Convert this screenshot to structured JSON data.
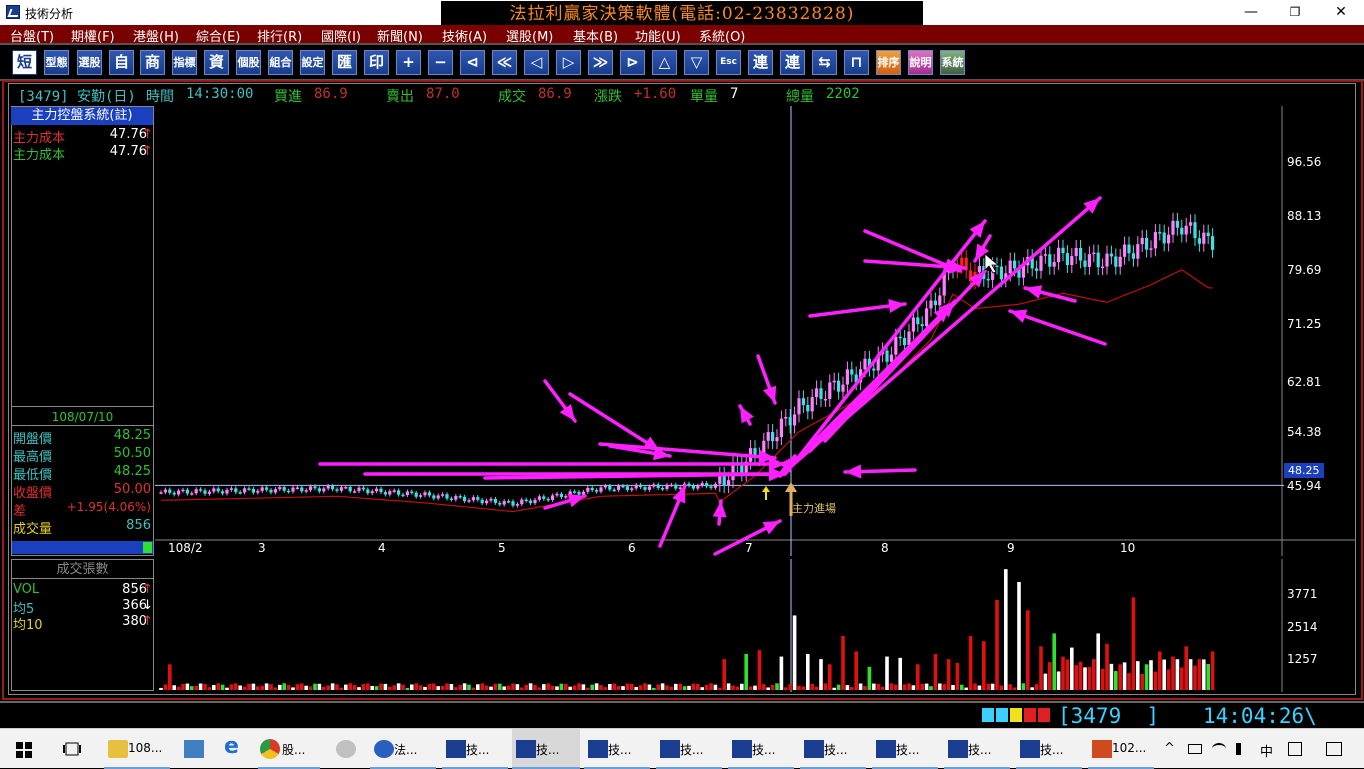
{
  "window": {
    "title": "技術分析",
    "banner": "法拉利贏家決策軟體(電話:02-23832828)",
    "minimize": "—",
    "maximize": "❐",
    "close": "✕"
  },
  "menu": [
    "台盤(T)",
    "期權(F)",
    "港盤(H)",
    "綜合(E)",
    "排行(R)",
    "國際(I)",
    "新聞(N)",
    "技術(A)",
    "選股(M)",
    "基本(B)",
    "功能(U)",
    "系統(O)"
  ],
  "toolbar": [
    "短",
    "型態",
    "選股",
    "自",
    "商",
    "指標",
    "資",
    "個股",
    "組合",
    "設定",
    "匯",
    "印",
    "+",
    "−",
    "⊲",
    "≪",
    "◁",
    "▷",
    "≫",
    "⊳",
    "△",
    "▽",
    "Esc",
    "連",
    "連",
    "⇆",
    "⊓",
    "排序",
    "說明",
    "系統"
  ],
  "info": {
    "code": "[3479] 安勤(日)",
    "time_label": "時間",
    "time": "14:30:00",
    "bid_label": "買進",
    "bid": "86.9",
    "ask_label": "賣出",
    "ask": "87.0",
    "deal_label": "成交",
    "deal": "86.9",
    "change_label": "漲跌",
    "change": "+1.60",
    "lot_label": "單量",
    "lot": "7",
    "total_label": "總量",
    "total": "2202"
  },
  "panel": {
    "title": "主力控盤系統(註)",
    "cost1_label": "主力成本",
    "cost1": "47.76",
    "cost2_label": "主力成本",
    "cost2": "47.76",
    "date": "108/07/10",
    "open_label": "開盤價",
    "open": "48.25",
    "high_label": "最高價",
    "high": "50.50",
    "low_label": "最低價",
    "low": "48.25",
    "close_label": "收盤價",
    "close": "50.00",
    "diff_label": "差",
    "diff": "+1.95(4.06%)",
    "volume_label": "成交量",
    "volume": "856",
    "arrow_up": "↑",
    "arrow_down": "↓"
  },
  "volume_panel": {
    "title": "成交張數",
    "vol_label": "VOL",
    "vol": "856",
    "ma5_label": "均5",
    "ma5": "366",
    "ma10_label": "均10",
    "ma10": "380"
  },
  "chart_labels": {
    "entry": "主力進場",
    "current_price": "48.25"
  },
  "chart_data": [
    {
      "type": "candlestick",
      "ylim": [
        40,
        104
      ],
      "y_ticks": [
        "96.56",
        "88.13",
        "79.69",
        "71.25",
        "62.81",
        "54.38",
        "45.94"
      ],
      "x_ticks": [
        "108/2",
        "3",
        "4",
        "5",
        "6",
        "7",
        "8",
        "9",
        "10"
      ],
      "crosshair_price": 48.25,
      "series": [
        "candles",
        "cost-line (red)"
      ],
      "trend_points": [
        [
          0,
          47.2
        ],
        [
          20,
          47.5
        ],
        [
          40,
          47.8
        ],
        [
          60,
          46.8
        ],
        [
          80,
          45.5
        ],
        [
          100,
          47.8
        ],
        [
          126,
          48.25
        ],
        [
          135,
          53
        ],
        [
          145,
          60
        ],
        [
          155,
          64
        ],
        [
          165,
          68
        ],
        [
          175,
          75
        ],
        [
          180,
          82
        ],
        [
          185,
          80
        ],
        [
          195,
          81
        ],
        [
          205,
          83
        ],
        [
          215,
          82
        ],
        [
          225,
          85
        ],
        [
          232,
          87.5
        ],
        [
          238,
          85
        ]
      ]
    },
    {
      "type": "bar",
      "title": "成交張數",
      "y_ticks": [
        "3771",
        "2514",
        "1257"
      ],
      "ylim": [
        0,
        4900
      ]
    }
  ],
  "status": {
    "code": "[3479  ]",
    "time": "14:04:26\\"
  },
  "taskbar": {
    "items": [
      {
        "label": "108...",
        "icon": "folder-icon"
      },
      {
        "label": "",
        "icon": "computer-icon"
      },
      {
        "label": "",
        "icon": "ie-icon"
      },
      {
        "label": "股...",
        "icon": "chrome-icon"
      },
      {
        "label": "",
        "icon": "paint-icon"
      },
      {
        "label": "法...",
        "icon": "ferrari-app-icon"
      },
      {
        "label": "技...",
        "icon": "chart-app-icon"
      },
      {
        "label": "技...",
        "icon": "chart-app-icon"
      },
      {
        "label": "技...",
        "icon": "chart-app-icon"
      },
      {
        "label": "技...",
        "icon": "chart-app-icon"
      },
      {
        "label": "技...",
        "icon": "chart-app-icon"
      },
      {
        "label": "技...",
        "icon": "chart-app-icon"
      },
      {
        "label": "技...",
        "icon": "chart-app-icon"
      },
      {
        "label": "技...",
        "icon": "chart-app-icon"
      },
      {
        "label": "技...",
        "icon": "chart-app-icon"
      },
      {
        "label": "102...",
        "icon": "powerpoint-icon"
      }
    ],
    "ime": "中",
    "tray_up": "^"
  }
}
